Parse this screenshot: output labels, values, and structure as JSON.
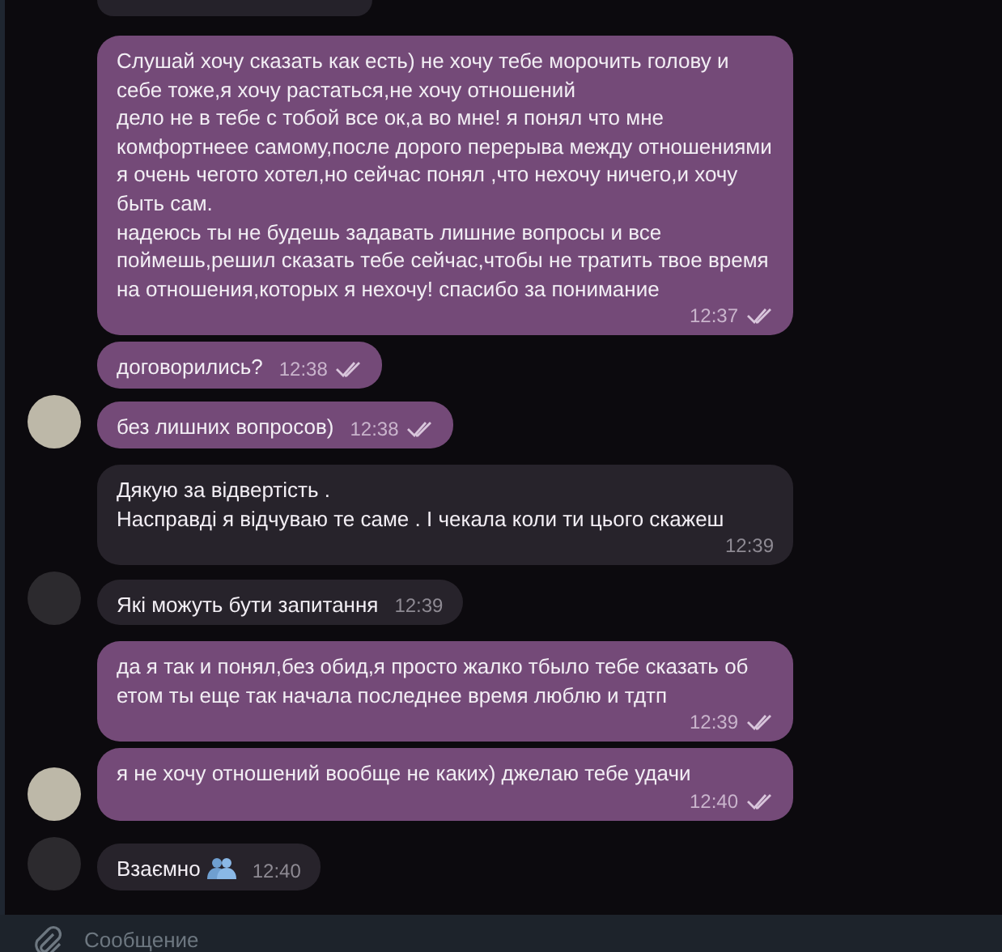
{
  "messages": [
    {
      "kind": "outgoing",
      "text": "Слушай хочу сказать как есть) не хочу тебе морочить голову и себе тоже,я хочу растаться,не хочу отношений\nдело не в тебе с тобой все ок,а во мне! я понял что мне комфортнеее самому,после дорого перерыва между отношениями я очень чегото хотел,но сейчас понял ,что нехочу ничего,и хочу быть сам.\nнадеюсь ты не будешь задавать лишние вопросы и все поймешь,решил сказать тебе сейчас,чтобы не тратить твое время на отношения,которых я нехочу! спасибо за понимание",
      "time": "12:37",
      "read": true,
      "avatar": false
    },
    {
      "kind": "outgoing",
      "text": "договорились?",
      "time": "12:38",
      "read": true,
      "avatar": false
    },
    {
      "kind": "outgoing",
      "text": "без лишних вопросов)",
      "time": "12:38",
      "read": true,
      "avatar": true
    },
    {
      "kind": "incoming",
      "text": "Дякую за відвертість .\nНасправді я відчуваю те саме . І чекала коли ти цього скажеш",
      "time": "12:39",
      "avatar": false
    },
    {
      "kind": "incoming",
      "text": "Які можуть бути запитання",
      "time": "12:39",
      "avatar": true
    },
    {
      "kind": "outgoing",
      "text": "да я так и понял,без обид,я просто жалко тбыло тебе сказать об етом ты еще так начала последнее время люблю и тдтп",
      "time": "12:39",
      "read": true,
      "avatar": false
    },
    {
      "kind": "outgoing",
      "text": "я не хочу отношений вообще не каких) джелаю тебе удачи",
      "time": "12:40",
      "read": true,
      "avatar": true
    },
    {
      "kind": "incoming",
      "text": "Взаємно",
      "emoji": true,
      "time": "12:40",
      "avatar": true
    }
  ],
  "composer": {
    "placeholder": "Сообщение"
  }
}
